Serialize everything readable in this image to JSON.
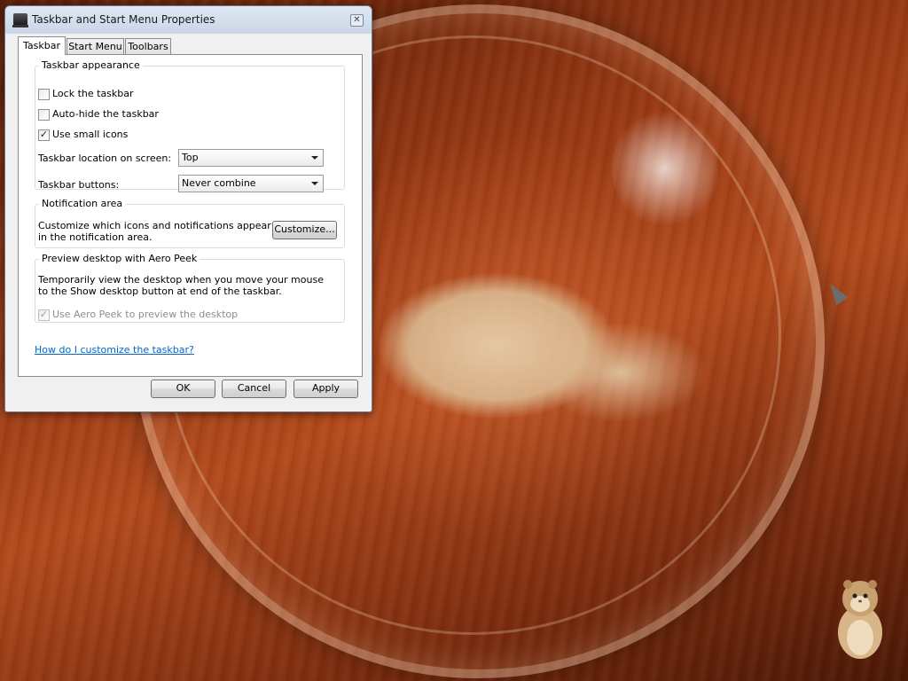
{
  "window": {
    "title": "Taskbar and Start Menu Properties",
    "close_glyph": "✕"
  },
  "tabs": [
    {
      "label": "Taskbar",
      "active": true
    },
    {
      "label": "Start Menu",
      "active": false
    },
    {
      "label": "Toolbars",
      "active": false
    }
  ],
  "appearance": {
    "group_label": "Taskbar appearance",
    "lock": {
      "label": "Lock the taskbar",
      "checked": false
    },
    "autohide": {
      "label": "Auto-hide the taskbar",
      "checked": false
    },
    "small_icons": {
      "label": "Use small icons",
      "checked": true,
      "mark": "✓"
    },
    "location_label": "Taskbar location on screen:",
    "location_value": "Top",
    "buttons_label": "Taskbar buttons:",
    "buttons_value": "Never combine"
  },
  "notification": {
    "group_label": "Notification area",
    "text": "Customize which icons and notifications appear in the notification area.",
    "customize_button": "Customize..."
  },
  "aero": {
    "group_label": "Preview desktop with Aero Peek",
    "text": "Temporarily view the desktop when you move your mouse to the Show desktop button at end of the taskbar.",
    "checkbox": {
      "label": "Use Aero Peek to preview the desktop",
      "checked": true,
      "enabled": false,
      "mark": "✓"
    }
  },
  "help_link": "How do I customize the taskbar?",
  "footer": {
    "ok": "OK",
    "cancel": "Cancel",
    "apply": "Apply"
  }
}
